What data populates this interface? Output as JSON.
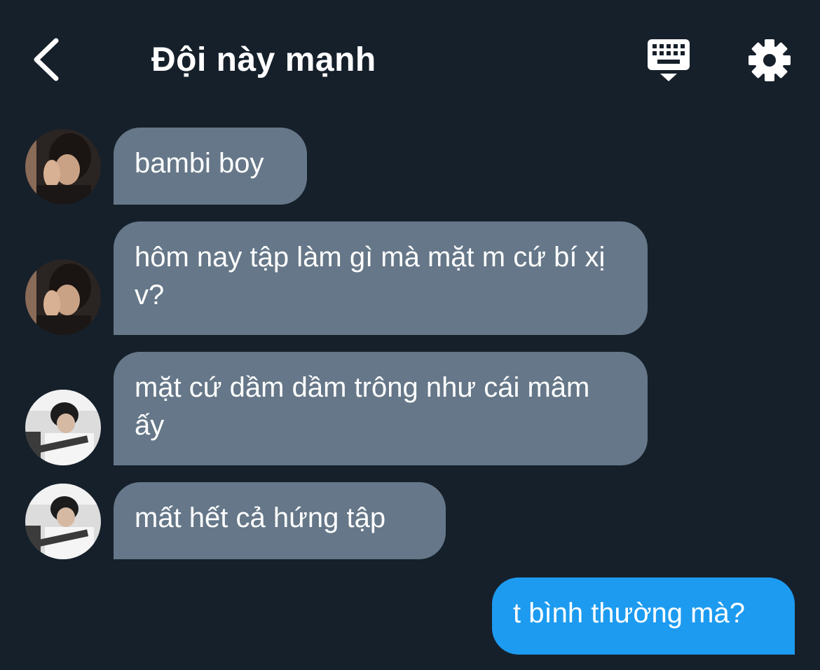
{
  "header": {
    "title": "Đội này mạnh",
    "back_icon": "chevron-left-icon",
    "keyboard_icon": "keyboard-icon",
    "settings_icon": "gear-icon"
  },
  "colors": {
    "background": "#16202b",
    "incoming_bubble": "#657788",
    "outgoing_bubble": "#1d9bf0",
    "text": "#ffffff"
  },
  "messages": [
    {
      "sender": "avatar-a",
      "direction": "incoming",
      "text": "bambi boy"
    },
    {
      "sender": "avatar-a",
      "direction": "incoming",
      "text": "hôm nay tập làm gì mà mặt m cứ bí xị v?"
    },
    {
      "sender": "avatar-b",
      "direction": "incoming",
      "text": "mặt cứ dầm dầm trông như cái mâm ấy"
    },
    {
      "sender": "avatar-b",
      "direction": "incoming",
      "text": "mất hết cả hứng tập"
    },
    {
      "sender": "me",
      "direction": "outgoing",
      "text": "t bình thường mà?"
    }
  ]
}
